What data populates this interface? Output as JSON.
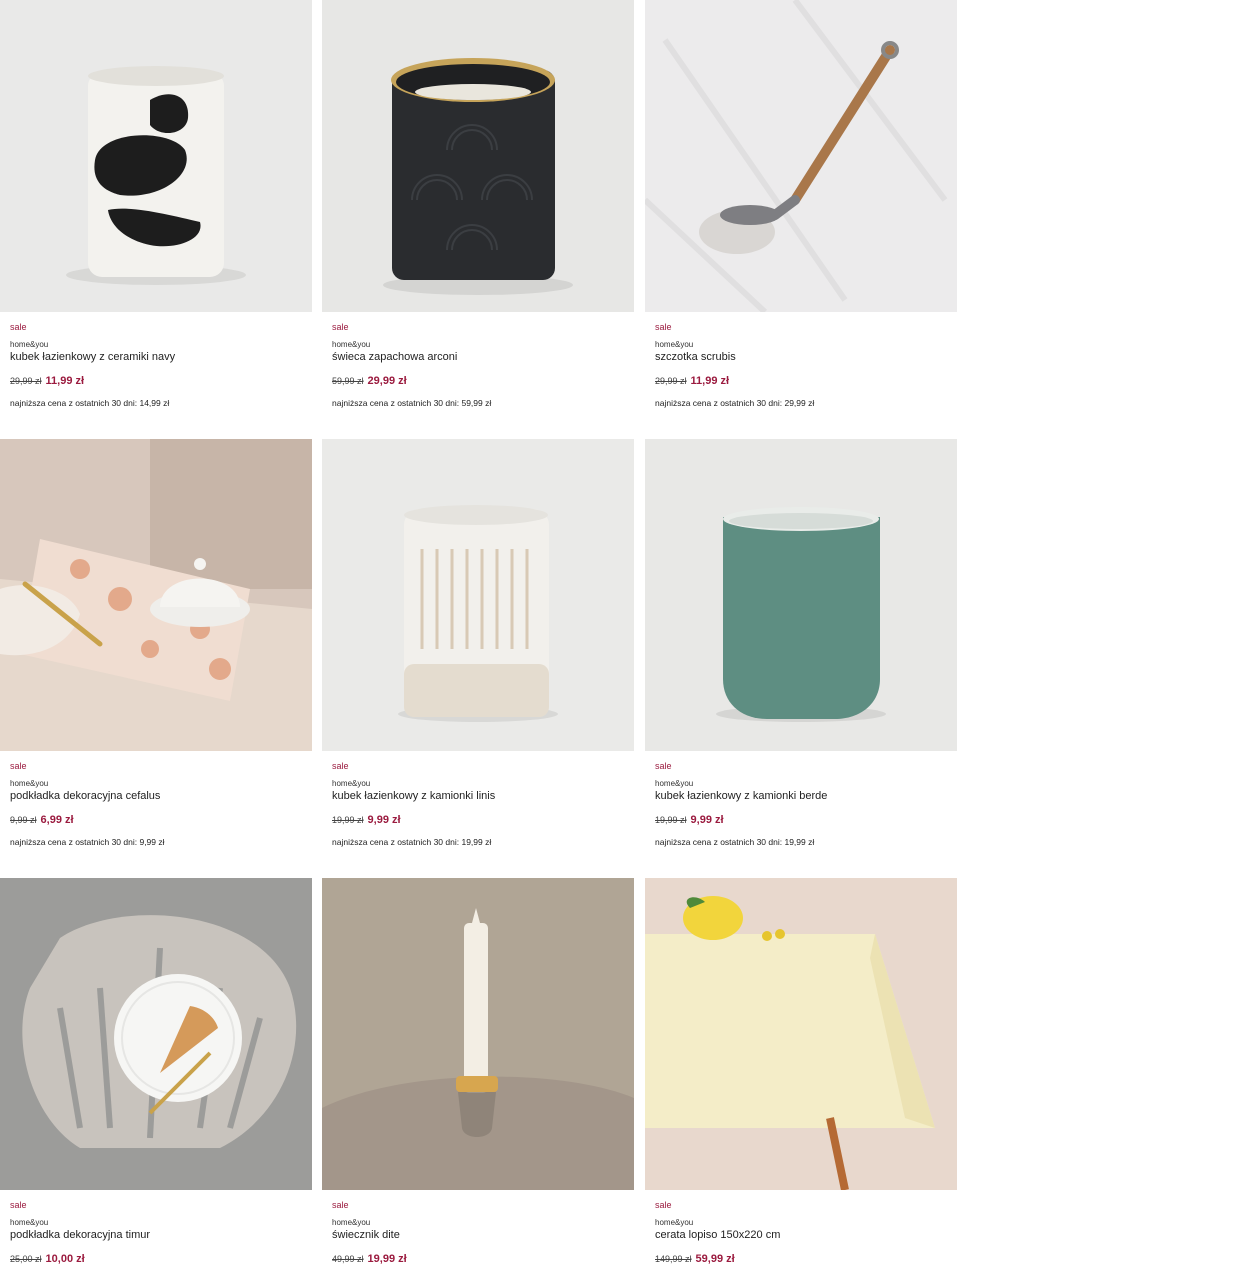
{
  "products": [
    {
      "badge": "sale",
      "brand": "home&you",
      "name": "kubek łazienkowy z ceramiki navy",
      "old_price": "29,99 zł",
      "new_price": "11,99 zł",
      "lowest": "najniższa cena z ostatnich 30 dni: 14,99 zł"
    },
    {
      "badge": "sale",
      "brand": "home&you",
      "name": "świeca zapachowa arconi",
      "old_price": "59,99 zł",
      "new_price": "29,99 zł",
      "lowest": "najniższa cena z ostatnich 30 dni: 59,99 zł"
    },
    {
      "badge": "sale",
      "brand": "home&you",
      "name": "szczotka scrubis",
      "old_price": "29,99 zł",
      "new_price": "11,99 zł",
      "lowest": "najniższa cena z ostatnich 30 dni: 29,99 zł"
    },
    {
      "badge": "sale",
      "brand": "home&you",
      "name": "podkładka dekoracyjna cefalus",
      "old_price": "9,99 zł",
      "new_price": "6,99 zł",
      "lowest": "najniższa cena z ostatnich 30 dni: 9,99 zł"
    },
    {
      "badge": "sale",
      "brand": "home&you",
      "name": "kubek łazienkowy z kamionki linis",
      "old_price": "19,99 zł",
      "new_price": "9,99 zł",
      "lowest": "najniższa cena z ostatnich 30 dni: 19,99 zł"
    },
    {
      "badge": "sale",
      "brand": "home&you",
      "name": "kubek łazienkowy z kamionki berde",
      "old_price": "19,99 zł",
      "new_price": "9,99 zł",
      "lowest": "najniższa cena z ostatnich 30 dni: 19,99 zł"
    },
    {
      "badge": "sale",
      "brand": "home&you",
      "name": "podkładka dekoracyjna timur",
      "old_price": "25,00 zł",
      "new_price": "10,00 zł",
      "lowest": ""
    },
    {
      "badge": "sale",
      "brand": "home&you",
      "name": "świecznik dite",
      "old_price": "49,99 zł",
      "new_price": "19,99 zł",
      "lowest": ""
    },
    {
      "badge": "sale",
      "brand": "home&you",
      "name": "cerata lopiso 150x220 cm",
      "old_price": "149,99 zł",
      "new_price": "59,99 zł",
      "lowest": ""
    }
  ],
  "colors": {
    "sale": "#9b1b3f"
  }
}
